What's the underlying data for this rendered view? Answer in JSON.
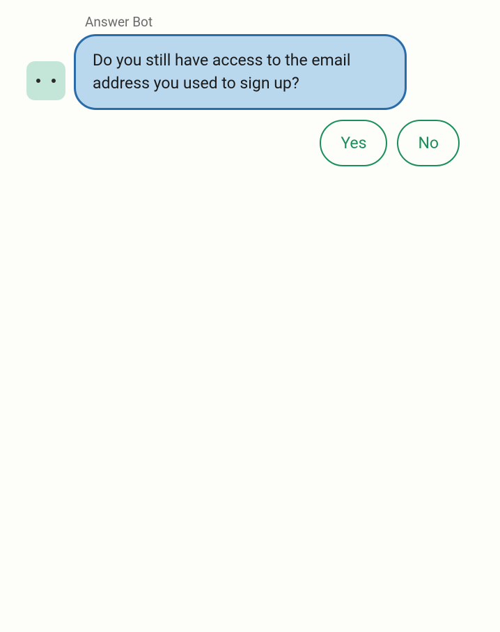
{
  "sender": {
    "name": "Answer Bot"
  },
  "message": {
    "text": "Do you still have access to the email address you used to sign up?"
  },
  "quick_replies": {
    "yes": "Yes",
    "no": "No"
  }
}
